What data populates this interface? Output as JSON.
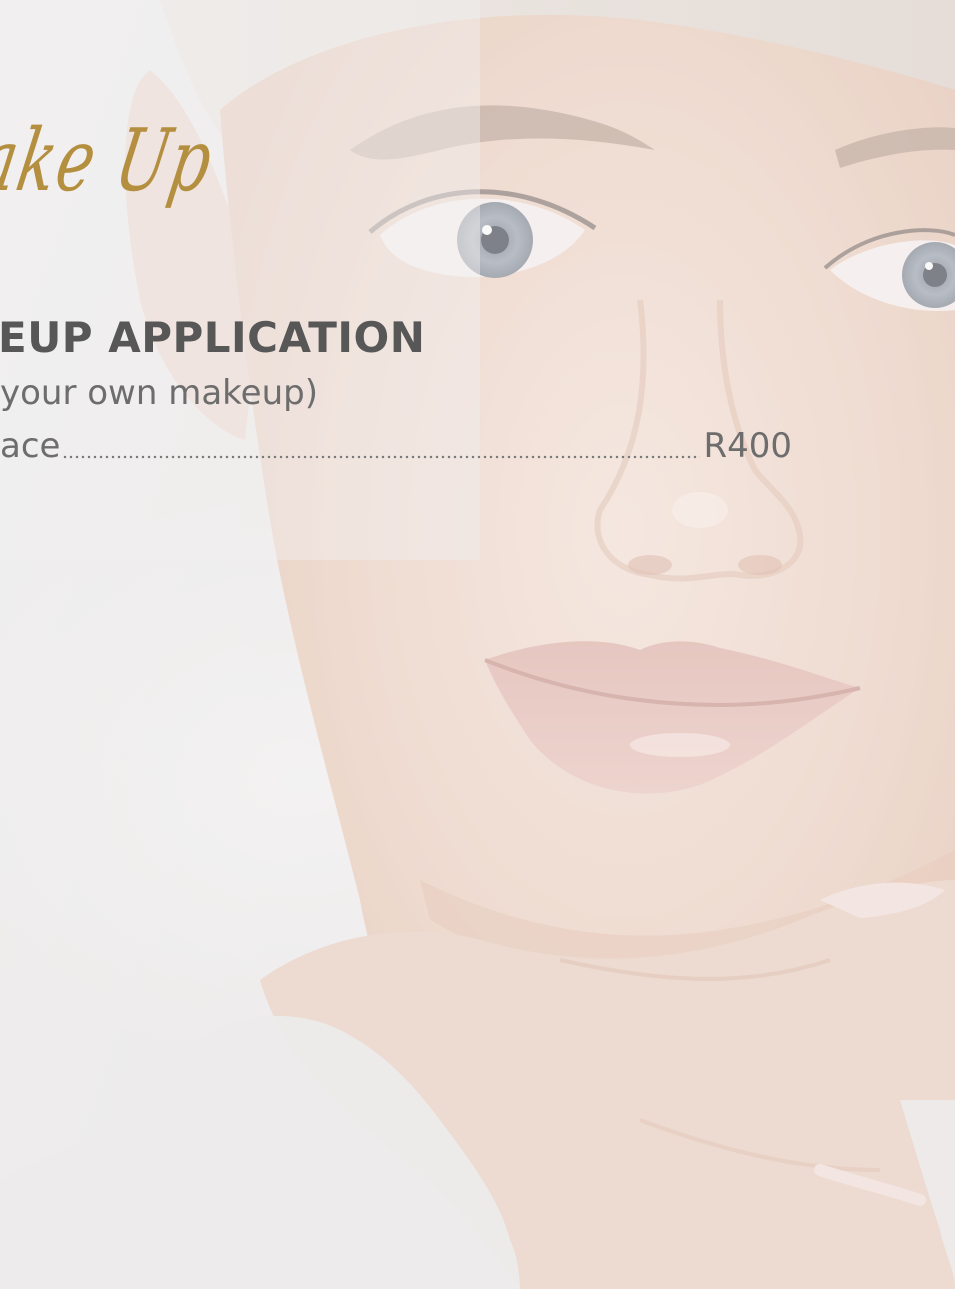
{
  "heading": {
    "script_title": "ake Up"
  },
  "service": {
    "title": "EUP APPLICATION",
    "note": "your own makeup)",
    "item": "ace",
    "price": "R400"
  },
  "colors": {
    "gold_accent": "#b48f3f",
    "title_gray": "#575757",
    "text_gray": "#6d6d6d",
    "background": "#ecebeb"
  }
}
